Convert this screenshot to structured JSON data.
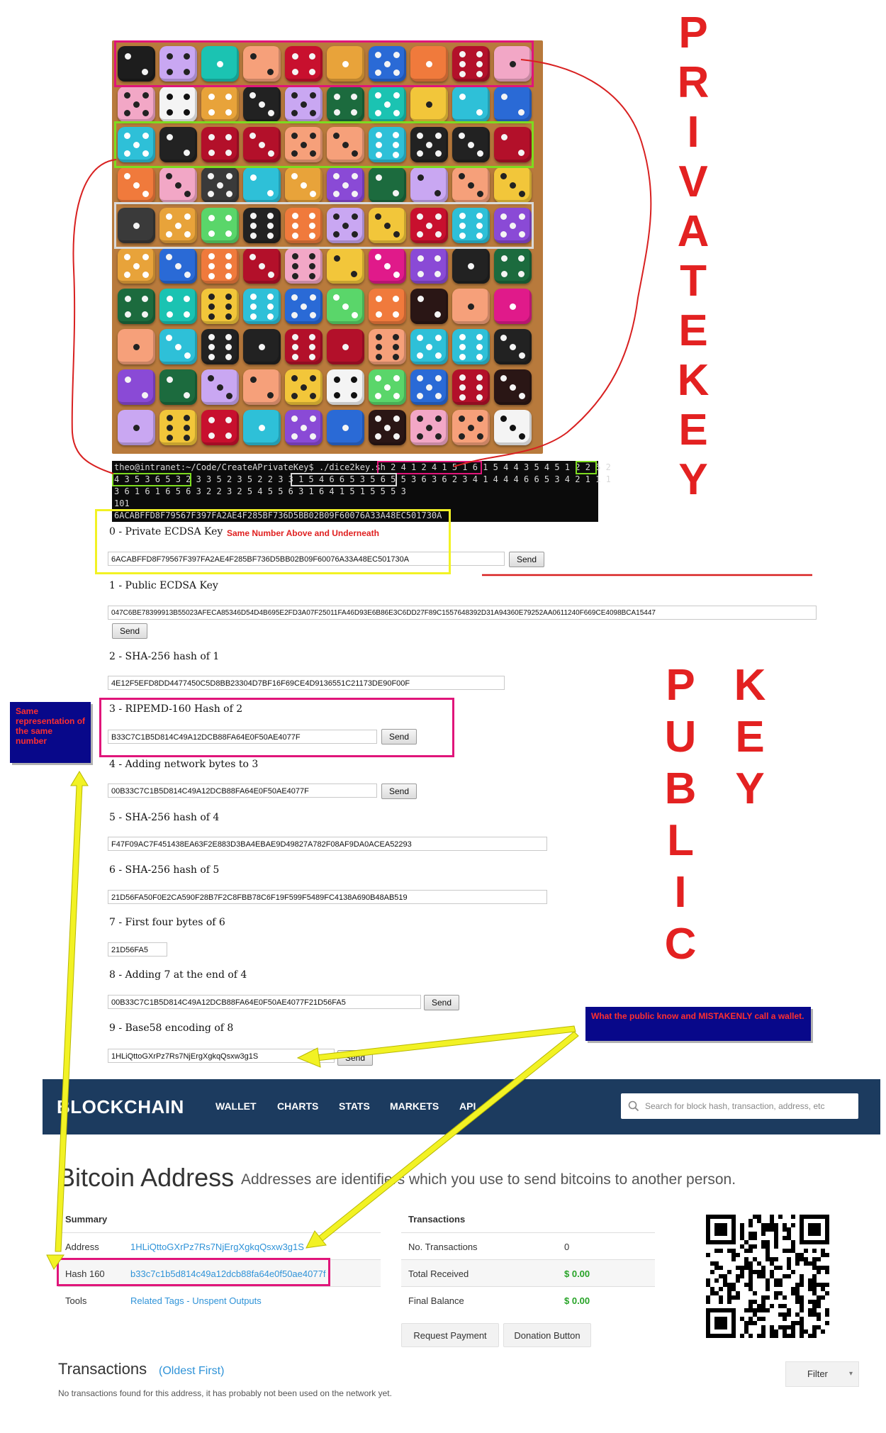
{
  "terminal": {
    "line1_prompt": "theo@intranet:~/Code/CreateAPrivateKey$ ./dice2key.sh ",
    "line1_seg_a": "2 4 1 2 4 1 5 1 6 1",
    "line1_seg_b": " 5 4 4 3 5 4 5 1 2 2 ",
    "line1_seg_c": "5 2",
    "line2_seg_a": "4 3 5 3 6 5 3 2",
    "line2_seg_b": " 3 3 5 2 3 5 2 2 3 3 ",
    "line2_seg_c": "1 5 4 6 6 5 3 5 6 5",
    "line2_seg_d": " 5 3 6 3 6 2 3 4 1 4 4 4 6 6 5 3 4 2 1 1 1",
    "line3": "3 6 1 6 1 6 5 6 3 2 2 3 2 5 4 5 5 6 3 1 6 4 1 5 1 5 5 5 3",
    "line4": "101",
    "line5": "6ACABFFD8F79567F397FA2AE4F285BF736D5BB02B09F60076A33A48EC501730A"
  },
  "steps": [
    {
      "label": "0 - Private ECDSA Key",
      "value": "6ACABFFD8F79567F397FA2AE4F285BF736D5BB02B09F60076A33A48EC501730A",
      "send": "Send"
    },
    {
      "label": "1 - Public ECDSA Key",
      "value": "047C6BE78399913B55023AFECA85346D54D4B695E2FD3A07F25011FA46D93E6B86E3C6DD27F89C1557648392D31A94360E79252AA0611240F669CE4098BCA15447",
      "send": "Send"
    },
    {
      "label": "2 - SHA-256 hash of 1",
      "value": "4E12F5EFD8DD4477450C5D8BB23304D7BF16F69CE4D9136551C21173DE90F00F"
    },
    {
      "label": "3 - RIPEMD-160 Hash of 2",
      "value": "B33C7C1B5D814C49A12DCB88FA64E0F50AE4077F",
      "send": "Send"
    },
    {
      "label": "4 - Adding network bytes to 3",
      "value": "00B33C7C1B5D814C49A12DCB88FA64E0F50AE4077F",
      "send": "Send"
    },
    {
      "label": "5 - SHA-256 hash of 4",
      "value": "F47F09AC7F451438EA63F2E883D3BA4EBAE9D49827A782F08AF9DA0ACEA52293"
    },
    {
      "label": "6 - SHA-256 hash of 5",
      "value": "21D56FA50F0E2CA590F28B7F2C8FBB78C6F19F599F5489FC4138A690B48AB519"
    },
    {
      "label": "7 - First four bytes of 6",
      "value": "21D56FA5"
    },
    {
      "label": "8 - Adding 7 at the end of 4",
      "value": "00B33C7C1B5D814C49A12DCB88FA64E0F50AE4077F21D56FA5",
      "send": "Send"
    },
    {
      "label": "9 - Base58 encoding of 8",
      "value": "1HLiQttoGXrPz7Rs7NjErgXgkqQsxw3g1S",
      "send": "Send"
    }
  ],
  "annotations": {
    "same_number": "Same Number Above and Underneath",
    "same_representation": "Same representation of the same number",
    "public_wallet": "What the public know and MISTAKENLY call a wallet.",
    "private_key_word1": [
      "P",
      "R",
      "I",
      "V",
      "A",
      "T",
      "E"
    ],
    "private_key_word2": [
      "K",
      "E",
      "Y"
    ],
    "public_word": [
      "P",
      "U",
      "B",
      "L",
      "I",
      "C"
    ],
    "public_key_word2": [
      "K",
      "E",
      "Y"
    ]
  },
  "blockchain": {
    "logo": "BLOCKCHAIN",
    "nav": [
      "WALLET",
      "CHARTS",
      "STATS",
      "MARKETS",
      "API"
    ],
    "search_placeholder": "Search for block hash, transaction, address, etc",
    "title": "Bitcoin Address",
    "subtitle": "Addresses are identifiers which you use to send bitcoins to another person.",
    "summary": {
      "header": "Summary",
      "address_label": "Address",
      "address_value": "1HLiQttoGXrPz7Rs7NjErgXgkqQsxw3g1S",
      "hash_label": "Hash 160",
      "hash_value": "b33c7c1b5d814c49a12dcb88fa64e0f50ae4077f",
      "tools_label": "Tools",
      "tools_related": "Related Tags",
      "tools_sep": " - ",
      "tools_unspent": "Unspent Outputs"
    },
    "transactions_table": {
      "header": "Transactions",
      "no_tx_label": "No. Transactions",
      "no_tx_value": "0",
      "total_label": "Total Received",
      "total_value": "$ 0.00",
      "balance_label": "Final Balance",
      "balance_value": "$ 0.00"
    },
    "request_payment": "Request Payment",
    "donation_button": "Donation Button",
    "tx_title": "Transactions",
    "tx_oldest": "(Oldest First)",
    "tx_none": "No transactions found for this address, it has probably not been used on the network yet.",
    "filter": "Filter"
  },
  "colors": {
    "highlight_magenta": "#e0157a",
    "highlight_green": "#7ddc1f",
    "highlight_yellow": "#f2f224",
    "highlight_white": "#d9d9d9",
    "annotation_red": "#e32121",
    "note_blue": "#08088a",
    "blockchain_navy": "#1c3b5f",
    "link_blue": "#2f93d8",
    "amount_green": "#27a327"
  }
}
